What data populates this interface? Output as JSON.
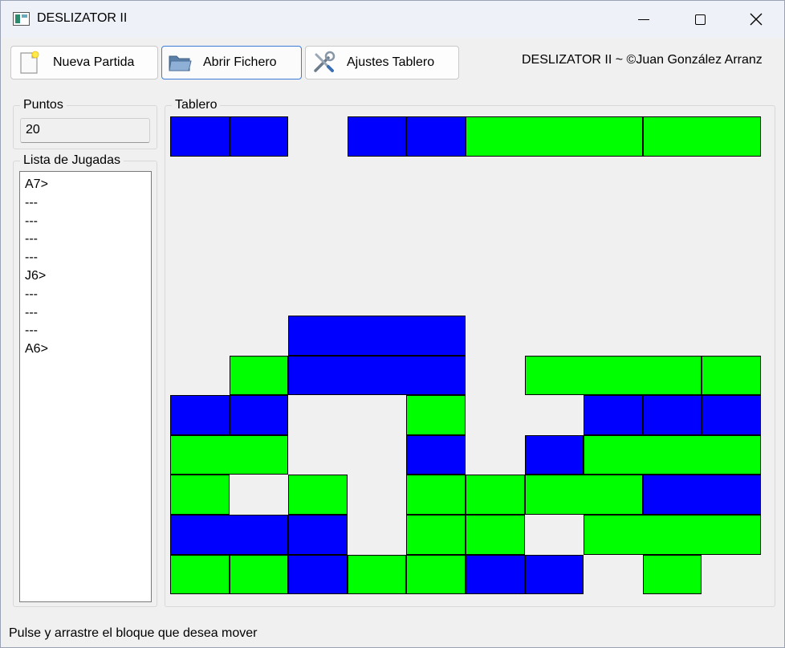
{
  "window": {
    "title": "DESLIZATOR II"
  },
  "icons": {
    "app": "app-icon",
    "minimize": "minimize-icon",
    "maximize": "maximize-icon",
    "close": "close-icon",
    "new_game": "new-document-icon",
    "open_file": "folder-icon",
    "settings": "tools-icon"
  },
  "toolbar": {
    "new_game_label": "Nueva Partida",
    "open_file_label": "Abrir Fichero",
    "settings_label": "Ajustes Tablero"
  },
  "header": {
    "copyright": "DESLIZATOR II ~ ©Juan González Arranz"
  },
  "score": {
    "group_label": "Puntos",
    "value": "20"
  },
  "moves": {
    "group_label": "Lista de Jugadas",
    "items": [
      "A7>",
      "---",
      "---",
      "---",
      "---",
      "J6>",
      "---",
      "---",
      "---",
      "A6>"
    ]
  },
  "board": {
    "group_label": "Tablero",
    "columns": 10,
    "rows": 12,
    "colors": {
      "blue": "#0000ff",
      "green": "#00ff00",
      "border": "#000000"
    },
    "blocks": [
      {
        "row": 1,
        "col": 1,
        "len": 1,
        "color": "blue"
      },
      {
        "row": 1,
        "col": 2,
        "len": 1,
        "color": "blue"
      },
      {
        "row": 1,
        "col": 4,
        "len": 1,
        "color": "blue"
      },
      {
        "row": 1,
        "col": 5,
        "len": 1,
        "color": "blue"
      },
      {
        "row": 1,
        "col": 6,
        "len": 3,
        "color": "green"
      },
      {
        "row": 1,
        "col": 9,
        "len": 2,
        "color": "green"
      },
      {
        "row": 6,
        "col": 3,
        "len": 3,
        "color": "blue"
      },
      {
        "row": 7,
        "col": 2,
        "len": 1,
        "color": "green"
      },
      {
        "row": 7,
        "col": 3,
        "len": 3,
        "color": "blue"
      },
      {
        "row": 7,
        "col": 7,
        "len": 3,
        "color": "green"
      },
      {
        "row": 7,
        "col": 10,
        "len": 1,
        "color": "green"
      },
      {
        "row": 8,
        "col": 1,
        "len": 1,
        "color": "blue"
      },
      {
        "row": 8,
        "col": 2,
        "len": 1,
        "color": "blue"
      },
      {
        "row": 8,
        "col": 5,
        "len": 1,
        "color": "green"
      },
      {
        "row": 8,
        "col": 8,
        "len": 1,
        "color": "blue"
      },
      {
        "row": 8,
        "col": 9,
        "len": 1,
        "color": "blue"
      },
      {
        "row": 8,
        "col": 10,
        "len": 1,
        "color": "blue"
      },
      {
        "row": 9,
        "col": 1,
        "len": 2,
        "color": "green"
      },
      {
        "row": 9,
        "col": 5,
        "len": 1,
        "color": "blue"
      },
      {
        "row": 9,
        "col": 7,
        "len": 1,
        "color": "blue"
      },
      {
        "row": 9,
        "col": 8,
        "len": 3,
        "color": "green"
      },
      {
        "row": 10,
        "col": 1,
        "len": 1,
        "color": "green"
      },
      {
        "row": 10,
        "col": 3,
        "len": 1,
        "color": "green"
      },
      {
        "row": 10,
        "col": 5,
        "len": 1,
        "color": "green"
      },
      {
        "row": 10,
        "col": 6,
        "len": 1,
        "color": "green"
      },
      {
        "row": 10,
        "col": 7,
        "len": 2,
        "color": "green"
      },
      {
        "row": 10,
        "col": 9,
        "len": 2,
        "color": "blue"
      },
      {
        "row": 11,
        "col": 1,
        "len": 2,
        "color": "blue"
      },
      {
        "row": 11,
        "col": 3,
        "len": 1,
        "color": "blue"
      },
      {
        "row": 11,
        "col": 5,
        "len": 1,
        "color": "green"
      },
      {
        "row": 11,
        "col": 6,
        "len": 1,
        "color": "green"
      },
      {
        "row": 11,
        "col": 8,
        "len": 3,
        "color": "green"
      },
      {
        "row": 12,
        "col": 1,
        "len": 1,
        "color": "green"
      },
      {
        "row": 12,
        "col": 2,
        "len": 1,
        "color": "green"
      },
      {
        "row": 12,
        "col": 3,
        "len": 1,
        "color": "blue"
      },
      {
        "row": 12,
        "col": 4,
        "len": 1,
        "color": "green"
      },
      {
        "row": 12,
        "col": 5,
        "len": 1,
        "color": "green"
      },
      {
        "row": 12,
        "col": 6,
        "len": 1,
        "color": "blue"
      },
      {
        "row": 12,
        "col": 7,
        "len": 1,
        "color": "blue"
      },
      {
        "row": 12,
        "col": 9,
        "len": 1,
        "color": "green"
      }
    ]
  },
  "status": {
    "message": "Pulse y arrastre el bloque que desea mover"
  }
}
